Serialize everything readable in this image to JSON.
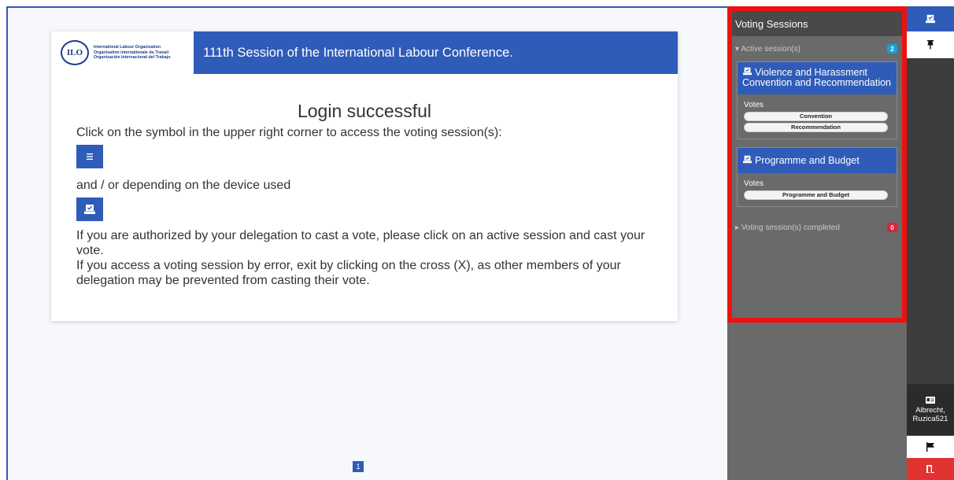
{
  "header": {
    "org_line1": "International Labour Organization",
    "org_line2": "Organisation internationale du Travail",
    "org_line3": "Organización Internacional del Trabajo",
    "logo_emblem": "ILO",
    "title": "111th Session of the International Labour Conference."
  },
  "content": {
    "login_title": "Login successful",
    "instruction1": "Click on the symbol in the upper right corner to access the voting session(s):",
    "instruction2": "and / or depending on the device used",
    "instruction3": "If you are authorized by your delegation to cast a vote, please click on an active session and cast your vote.",
    "instruction4": "If you access a voting session by error, exit by clicking on the cross (X), as other members of your delegation may be prevented from casting their vote."
  },
  "pagination": {
    "current_page": "1"
  },
  "voting_panel": {
    "title": "Voting Sessions",
    "active_label": "Active session(s)",
    "active_count": "2",
    "completed_label": "Voting session(s) completed",
    "completed_count": "0",
    "sessions": [
      {
        "title": "Violence and Harassment Convention and Recommendation",
        "votes_label": "Votes",
        "votes": [
          "Convention",
          "Recommendation"
        ]
      },
      {
        "title": "Programme and Budget",
        "votes_label": "Votes",
        "votes": [
          "Programme and Budget"
        ]
      }
    ]
  },
  "user": {
    "name_line1": "Albrecht,",
    "name_line2": "Ruzica521"
  },
  "colors": {
    "primary": "#2f5cb8",
    "panel_border": "#ee1111",
    "active_badge": "#17a2d8",
    "completed_badge": "#d9263a",
    "exit": "#e23333"
  },
  "icons": [
    "menu-icon",
    "ballot-icon",
    "pin-icon",
    "id-card-icon",
    "flag-icon",
    "exit-door-icon",
    "triangle-down-icon",
    "triangle-right-icon"
  ]
}
